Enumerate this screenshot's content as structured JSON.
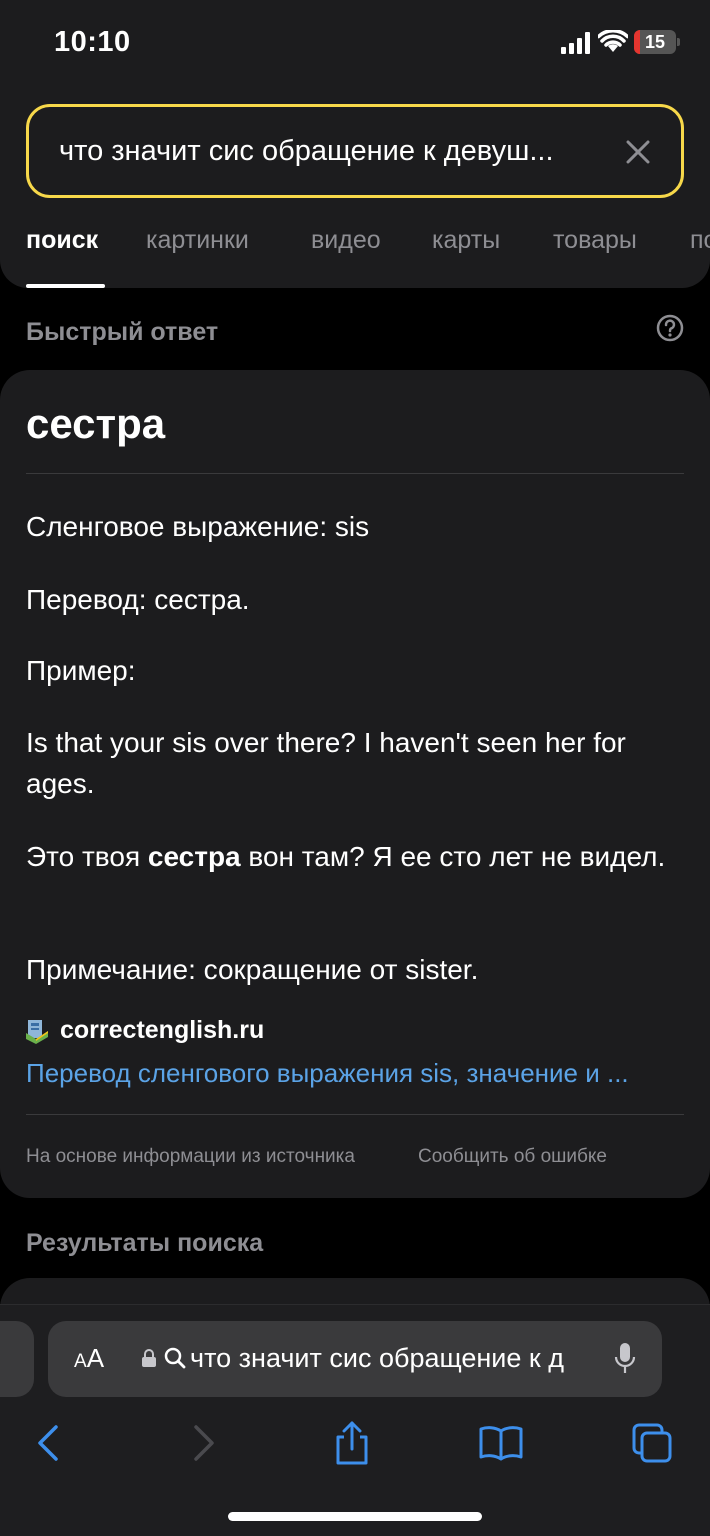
{
  "status_bar": {
    "time": "10:10",
    "battery_level": "15",
    "battery_fraction": 0.15,
    "battery_color": "#e5352f"
  },
  "search": {
    "query": "что значит сис обращение к девуш..."
  },
  "tabs": [
    {
      "label": "поиск",
      "active": true
    },
    {
      "label": "картинки"
    },
    {
      "label": "видео"
    },
    {
      "label": "карты"
    },
    {
      "label": "товары"
    },
    {
      "label": "по"
    }
  ],
  "quick_answer": {
    "section_label": "Быстрый ответ",
    "title": "сестра",
    "lines": {
      "slang": "Сленговое выражение: sis",
      "translation": "Перевод: сестра.",
      "example_label": "Пример:",
      "example_en": "Is that your sis over there? I haven't seen her for ages.",
      "example_ru_pre": "Это твоя ",
      "example_ru_bold": "сестра",
      "example_ru_post": " вон там? Я ее сто лет не видел.",
      "note": "Примечание: сокращение от sister."
    },
    "source": {
      "domain": "correctenglish.ru",
      "link_text": "Перевод сленгового выражения sis, значение и ..."
    },
    "footer": {
      "based_on": "На основе информации из источника",
      "report_error": "Сообщить об ошибке"
    }
  },
  "results": {
    "section_label": "Результаты поиска"
  },
  "browser": {
    "aa_small": "A",
    "aa_large": "A",
    "address_text": "что значит сис обращение к д"
  },
  "colors": {
    "accent_search_border": "#f7d84a",
    "link_blue": "#5ba3e6",
    "safari_blue": "#3d8fec"
  },
  "icons": [
    "signal-icon",
    "wifi-icon",
    "battery-icon",
    "clear-icon",
    "help-icon",
    "favicon-icon",
    "lock-icon",
    "search-icon",
    "mic-icon",
    "back-icon",
    "forward-icon",
    "share-icon",
    "bookmarks-icon",
    "tabs-icon"
  ]
}
